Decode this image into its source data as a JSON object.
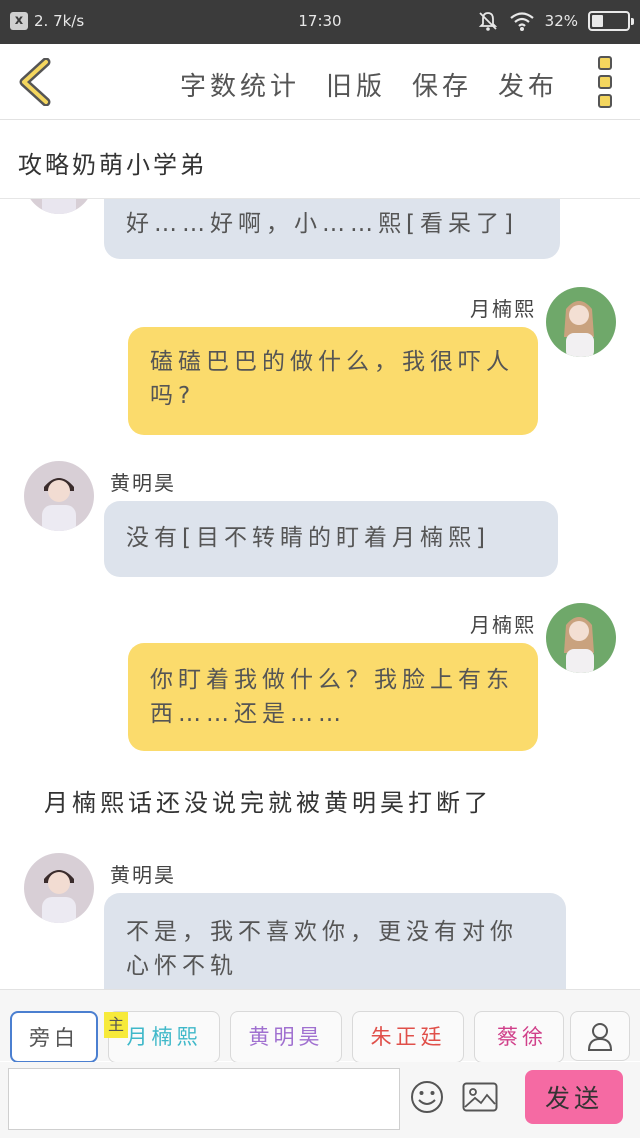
{
  "status_bar": {
    "net_speed": "2. 7k/s",
    "time": "17:30",
    "battery": "32%",
    "battery_level": 0.32
  },
  "toolbar": {
    "back_icon": "chevron-left-icon",
    "actions": [
      "字数统计",
      "旧版",
      "保存",
      "发布"
    ],
    "more_icon": "more-vertical-icon",
    "accent_color": "#f4d65e"
  },
  "story": {
    "title": "攻略奶萌小学弟"
  },
  "messages": [
    {
      "type": "bubble",
      "side": "left",
      "speaker": "",
      "text": "好……好啊，小……熙[看呆了]"
    },
    {
      "type": "bubble",
      "side": "right",
      "speaker": "月楠熙",
      "text": "磕磕巴巴的做什么，我很吓人吗?"
    },
    {
      "type": "bubble",
      "side": "left",
      "speaker": "黄明昊",
      "text": "没有[目不转睛的盯着月楠熙]"
    },
    {
      "type": "bubble",
      "side": "right",
      "speaker": "月楠熙",
      "text": "你盯着我做什么？我脸上有东西……还是……"
    },
    {
      "type": "narration",
      "text": "月楠熙话还没说完就被黄明昊打断了"
    },
    {
      "type": "bubble",
      "side": "left",
      "speaker": "黄明昊",
      "text": "不是，我不喜欢你，更没有对你心怀不轨"
    }
  ],
  "characters": {
    "main_tag": "主",
    "items": [
      {
        "label": "旁白",
        "color": "#555555"
      },
      {
        "label": "月楠熙",
        "color": "#3fb8c9"
      },
      {
        "label": "黄明昊",
        "color": "#a070d0"
      },
      {
        "label": "朱正廷",
        "color": "#e0504a"
      },
      {
        "label": "蔡徐坤",
        "color": "#d0408a"
      }
    ]
  },
  "input": {
    "value": "",
    "placeholder": "",
    "send_label": "发送",
    "send_color": "#f56aa3"
  }
}
